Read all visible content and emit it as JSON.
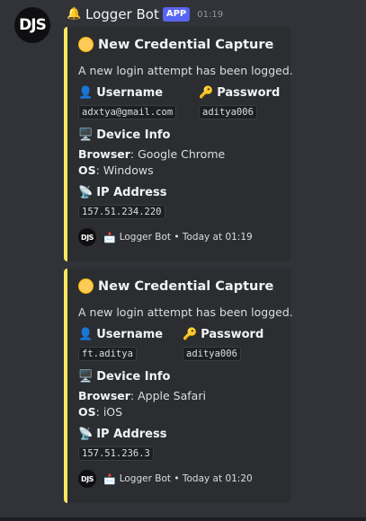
{
  "message": {
    "avatar_text": "DJS",
    "bot_icon": "bell-icon",
    "bot_name": "Logger Bot",
    "app_badge": "APP",
    "timestamp": "01:19"
  },
  "embeds": [
    {
      "accent_color": "#fee75c",
      "title_icon": "yellow-circle-icon",
      "title": "New Credential Capture",
      "description": "A new login attempt has been logged.",
      "username_label": "Username",
      "username_value": "adxtya@gmail.com",
      "password_label": "Password",
      "password_value": "aditya006",
      "device_label": "Device Info",
      "browser_label": "Browser",
      "browser_value": ": Google Chrome",
      "os_label": "OS",
      "os_value": ": Windows",
      "ip_label": "IP Address",
      "ip_value": "157.51.234.220",
      "footer_avatar_text": "DJS",
      "footer_text": "Logger Bot • Today at 01:19"
    },
    {
      "accent_color": "#fee75c",
      "title_icon": "yellow-circle-icon",
      "title": "New Credential Capture",
      "description": "A new login attempt has been logged.",
      "username_label": "Username",
      "username_value": "ft.aditya",
      "password_label": "Password",
      "password_value": "aditya006",
      "device_label": "Device Info",
      "browser_label": "Browser",
      "browser_value": ": Apple Safari",
      "os_label": "OS",
      "os_value": ": iOS",
      "ip_label": "IP Address",
      "ip_value": "157.51.236.3",
      "footer_avatar_text": "DJS",
      "footer_text": "Logger Bot • Today at 01:20"
    }
  ]
}
